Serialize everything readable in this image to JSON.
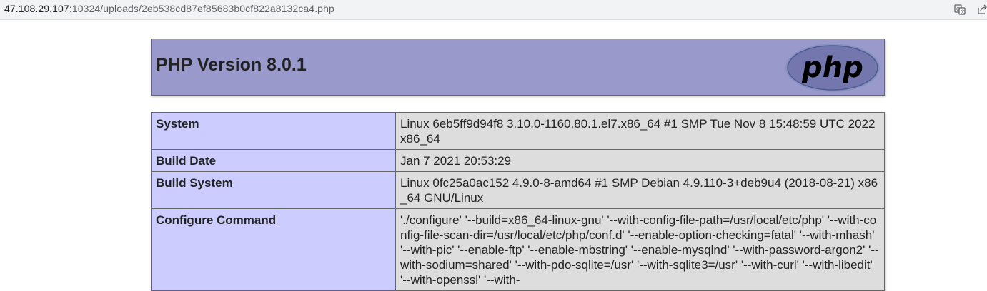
{
  "browser": {
    "url_host": "47.108.29.107",
    "url_rest": ":10324/uploads/2eb538cd87ef85683b0cf822a8132ca4.php",
    "icons": [
      "translate-icon",
      "share-icon"
    ]
  },
  "page": {
    "title": "PHP Version 8.0.1",
    "logo_text": "php"
  },
  "info_rows": [
    {
      "key": "System",
      "value": "Linux 6eb5ff9d94f8 3.10.0-1160.80.1.el7.x86_64 #1 SMP Tue Nov 8 15:48:59 UTC 2022 x86_64"
    },
    {
      "key": "Build Date",
      "value": "Jan 7 2021 20:53:29"
    },
    {
      "key": "Build System",
      "value": "Linux 0fc25a0ac152 4.9.0-8-amd64 #1 SMP Debian 4.9.110-3+deb9u4 (2018-08-21) x86_64 GNU/Linux"
    },
    {
      "key": "Configure Command",
      "value": "'./configure' '--build=x86_64-linux-gnu' '--with-config-file-path=/usr/local/etc/php' '--with-config-file-scan-dir=/usr/local/etc/php/conf.d' '--enable-option-checking=fatal' '--with-mhash' '--with-pic' '--enable-ftp' '--enable-mbstring' '--enable-mysqlnd' '--with-password-argon2' '--with-sodium=shared' '--with-pdo-sqlite=/usr' '--with-sqlite3=/usr' '--with-curl' '--with-libedit' '--with-openssl' '--with-"
    }
  ]
}
